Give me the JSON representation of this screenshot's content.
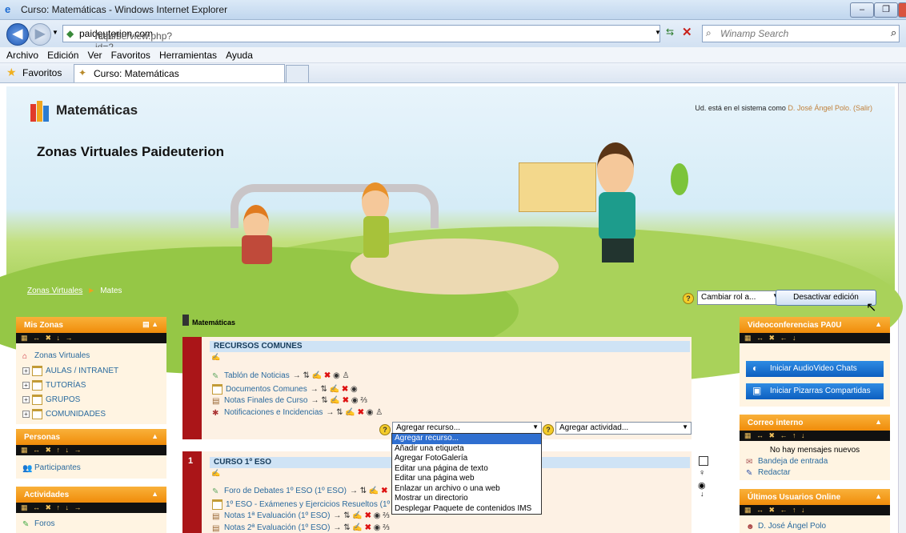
{
  "browser": {
    "title": "Curso: Matemáticas - Windows Internet Explorer",
    "url_prefix": "http://",
    "url_domain": "paideuterion.com",
    "url_path": "/course/view.php?id=2",
    "search_placeholder": "Winamp Search",
    "menu": [
      "Archivo",
      "Edición",
      "Ver",
      "Favoritos",
      "Herramientas",
      "Ayuda"
    ],
    "favorites_label": "Favoritos",
    "tab_title": "Curso: Matemáticas"
  },
  "header": {
    "site_title": "Matemáticas",
    "subtitle": "Zonas Virtuales Paideuterion",
    "login_prefix": "Ud. está en el sistema como",
    "login_user": "D. José Ángel Polo.",
    "logout": "(Salir)",
    "breadcrumb": [
      "Zonas Virtuales",
      "Mates"
    ],
    "role_select": "Cambiar rol a...",
    "edit_button": "Desactivar edición"
  },
  "left_blocks": {
    "miszonas": {
      "title": "Mis Zonas",
      "items": [
        "Zonas Virtuales",
        "AULAS / INTRANET",
        "TUTORÍAS",
        "GRUPOS",
        "COMUNIDADES"
      ]
    },
    "personas": {
      "title": "Personas",
      "items": [
        "Participantes"
      ]
    },
    "actividades": {
      "title": "Actividades",
      "items": [
        "Foros"
      ]
    }
  },
  "main": {
    "title": "Matemáticas",
    "section0": {
      "heading": "RECURSOS COMUNES",
      "resources": [
        "Tablón de Noticias",
        "Documentos Comunes",
        "Notas Finales de Curso",
        "Notificaciones e Incidencias"
      ],
      "add_resource": "Agregar recurso...",
      "add_activity": "Agregar actividad..."
    },
    "dropdown_options": [
      "Agregar recurso...",
      "Añadir una etiqueta",
      "Agregar FotoGalería",
      "Editar una página de texto",
      "Editar una página web",
      "Enlazar un archivo o una web",
      "Mostrar un directorio",
      "Desplegar Paquete de contenidos IMS"
    ],
    "section1": {
      "number": "1",
      "heading": "CURSO 1º ESO",
      "resources": [
        "Foro de Debates 1º ESO (1º ESO)",
        "1º ESO - Exámenes y Ejercicios Resueltos (1º ES",
        "Notas 1ª Evaluación (1º ESO)",
        "Notas 2ª Evaluación (1º ESO)"
      ]
    }
  },
  "right_blocks": {
    "video": {
      "title": "Videoconferencias PA0U",
      "buttons": [
        "Iniciar AudioVideo Chats",
        "Iniciar Pizarras Compartidas"
      ]
    },
    "mail": {
      "title": "Correo interno",
      "empty": "No hay mensajes nuevos",
      "links": [
        "Bandeja de entrada",
        "Redactar"
      ]
    },
    "online": {
      "title": "Últimos Usuarios Online",
      "users": [
        "D. José Ángel Polo"
      ]
    }
  }
}
